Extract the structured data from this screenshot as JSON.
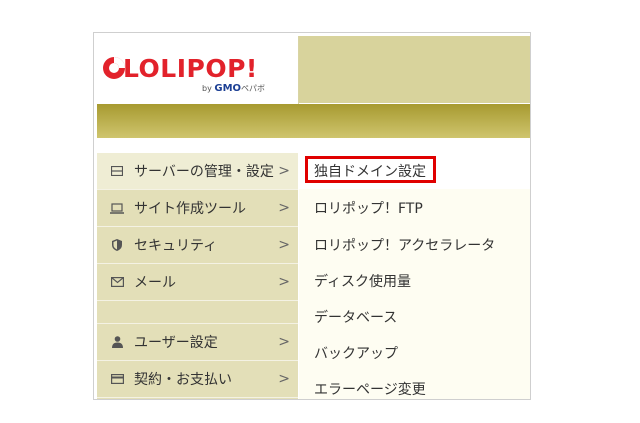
{
  "logo": {
    "brand": "LOLIPOP!",
    "by": "by",
    "company": "GMO",
    "company_suffix": "ペパボ"
  },
  "colors": {
    "accent": "#e2222b",
    "olive": "#a79a30",
    "sidebar_bg": "#e3dfb8",
    "highlight": "#e00000"
  },
  "sidebar": {
    "items": [
      {
        "label": "サーバーの管理・設定",
        "chevron": ">",
        "icon": "server-icon"
      },
      {
        "label": "サイト作成ツール",
        "chevron": ">",
        "icon": "laptop-icon"
      },
      {
        "label": "セキュリティ",
        "chevron": ">",
        "icon": "shield-icon"
      },
      {
        "label": "メール",
        "chevron": ">",
        "icon": "mail-icon"
      },
      {
        "label": "ユーザー設定",
        "chevron": ">",
        "icon": "user-icon"
      },
      {
        "label": "契約・お支払い",
        "chevron": ">",
        "icon": "credit-card-icon"
      }
    ]
  },
  "submenu": {
    "items": [
      {
        "label": "独自ドメイン設定"
      },
      {
        "label": "ロリポップ！FTP"
      },
      {
        "label": "ロリポップ！アクセラレータ"
      },
      {
        "label": "ディスク使用量"
      },
      {
        "label": "データベース"
      },
      {
        "label": "バックアップ"
      },
      {
        "label": "エラーページ変更"
      }
    ]
  }
}
